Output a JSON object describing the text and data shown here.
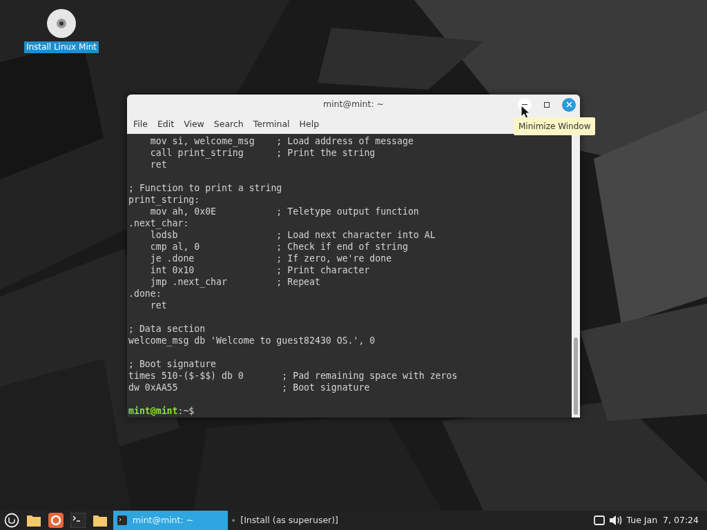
{
  "desktop_icons": [
    {
      "label": "Install Linux Mint",
      "selected": true
    }
  ],
  "window": {
    "title": "mint@mint: ~",
    "menu": [
      "File",
      "Edit",
      "View",
      "Search",
      "Terminal",
      "Help"
    ],
    "tooltip": "Minimize Window",
    "terminal": {
      "blocks": [
        [
          "    mov si, welcome_msg    ; Load address of message",
          "    call print_string      ; Print the string",
          "    ret"
        ],
        [
          "; Function to print a string",
          "print_string:",
          "    mov ah, 0x0E           ; Teletype output function",
          ".next_char:",
          "    lodsb                  ; Load next character into AL",
          "    cmp al, 0              ; Check if end of string",
          "    je .done               ; If zero, we're done",
          "    int 0x10               ; Print character",
          "    jmp .next_char         ; Repeat",
          ".done:",
          "    ret"
        ],
        [
          "; Data section",
          "welcome_msg db 'Welcome to guest82430 OS.', 0"
        ],
        [
          "; Boot signature",
          "times 510-($-$$) db 0       ; Pad remaining space with zeros",
          "dw 0xAA55                   ; Boot signature"
        ]
      ],
      "prompt": {
        "user_host": "mint@mint",
        "path": ":~$"
      }
    }
  },
  "taskbar": {
    "windows": [
      {
        "label": "mint@mint: ~",
        "selected": true
      },
      {
        "label": "[Install (as superuser)]",
        "selected": false
      }
    ],
    "clock": "Tue Jan  7, 07:24"
  }
}
